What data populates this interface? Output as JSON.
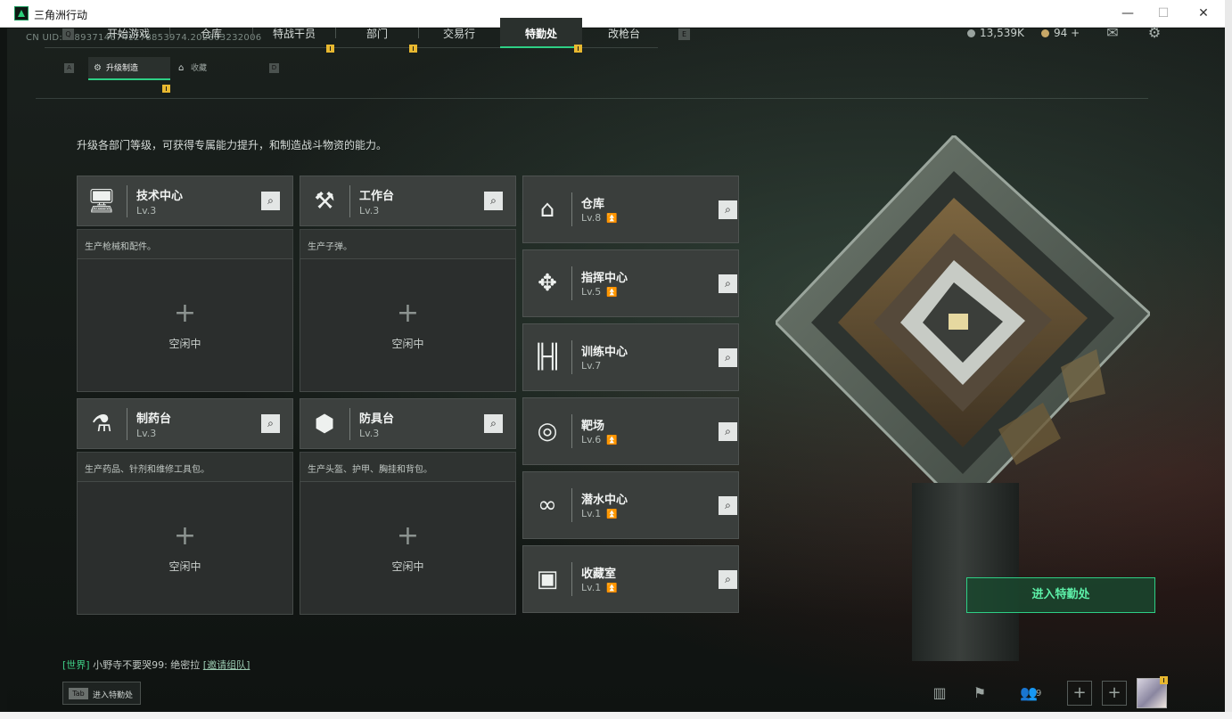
{
  "window": {
    "title": "三角洲行动",
    "min": "—",
    "max": "☐",
    "close": "✕"
  },
  "uid": "CN UID:188937146741278853974.202603232006",
  "nav": {
    "left_key": "Q",
    "right_key": "E",
    "tabs": [
      {
        "label": "开始游戏"
      },
      {
        "label": "仓库"
      },
      {
        "label": "特战干员"
      },
      {
        "label": "部门"
      },
      {
        "label": "交易行"
      },
      {
        "label": "特勤处"
      },
      {
        "label": "改枪台"
      }
    ],
    "active": "特勤处"
  },
  "currency": {
    "coins": "13,539K",
    "tickets": "94"
  },
  "subnav": {
    "left_key": "A",
    "right_key": "D",
    "tabs": [
      {
        "label": "升级制造"
      },
      {
        "label": "收藏"
      }
    ]
  },
  "description": "升级各部门等级，可获得专属能力提升，和制造战斗物资的能力。",
  "workshops": [
    {
      "name": "技术中心",
      "level": "Lv.3",
      "desc": "生产枪械和配件。",
      "status": "空闲中",
      "icon": "computer-icon"
    },
    {
      "name": "工作台",
      "level": "Lv.3",
      "desc": "生产子弹。",
      "status": "空闲中",
      "icon": "tools-icon"
    },
    {
      "name": "制药台",
      "level": "Lv.3",
      "desc": "生产药品、针剂和维修工具包。",
      "status": "空闲中",
      "icon": "microscope-icon"
    },
    {
      "name": "防具台",
      "level": "Lv.3",
      "desc": "生产头盔、护甲、胸挂和背包。",
      "status": "空闲中",
      "icon": "armor-icon"
    }
  ],
  "departments": [
    {
      "name": "仓库",
      "level": "Lv.8",
      "upgradable": true,
      "icon": "warehouse-icon"
    },
    {
      "name": "指挥中心",
      "level": "Lv.5",
      "upgradable": true,
      "icon": "command-icon"
    },
    {
      "name": "训练中心",
      "level": "Lv.7",
      "upgradable": false,
      "icon": "dumbbell-icon"
    },
    {
      "name": "靶场",
      "level": "Lv.6",
      "upgradable": true,
      "icon": "target-icon"
    },
    {
      "name": "潜水中心",
      "level": "Lv.1",
      "upgradable": true,
      "icon": "diving-mask-icon"
    },
    {
      "name": "收藏室",
      "level": "Lv.1",
      "upgradable": true,
      "icon": "collection-icon"
    }
  ],
  "enter_button": "进入特勤处",
  "chat": {
    "channel": "[世界]",
    "message": "小野寺不要哭99: 绝密拉",
    "invite": "[邀请组队]"
  },
  "tab_hint": {
    "key": "Tab",
    "label": "进入特勤处"
  },
  "friends_count": "9",
  "colors": {
    "accent": "#2ecf85",
    "alert": "#e8b830",
    "upgrade": "#e7b93c"
  }
}
